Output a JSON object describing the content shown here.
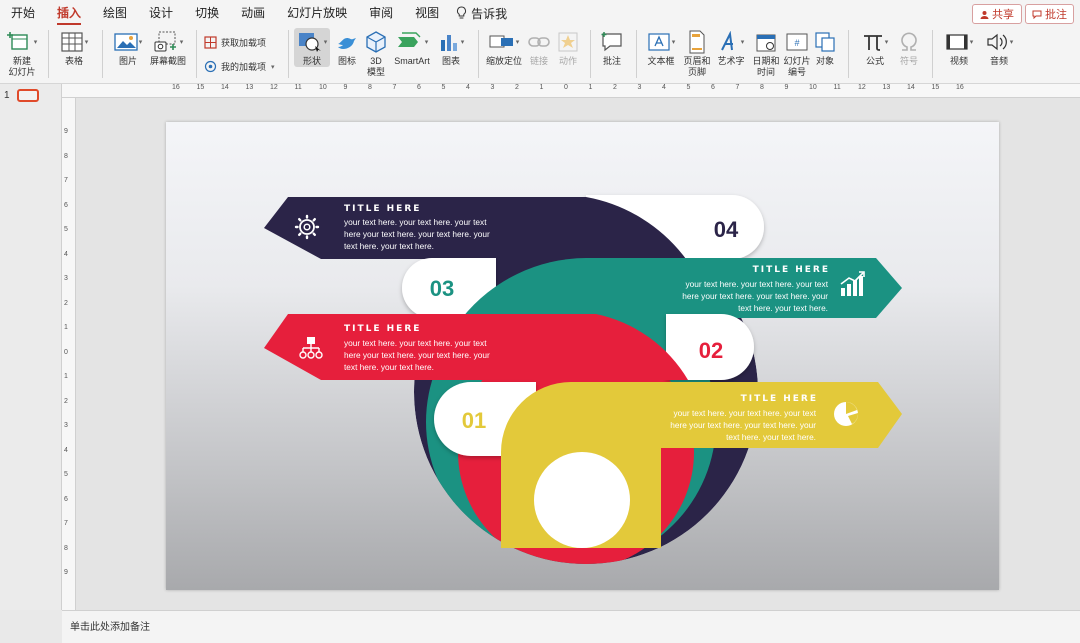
{
  "menu": {
    "items": [
      "开始",
      "插入",
      "绘图",
      "设计",
      "切换",
      "动画",
      "幻灯片放映",
      "审阅",
      "视图"
    ],
    "active": "插入",
    "tell_me": "告诉我",
    "share": "共享",
    "comments": "批注"
  },
  "ribbon": {
    "new_slide_1": "新建",
    "new_slide_2": "幻灯片",
    "table": "表格",
    "picture": "图片",
    "screenshot": "屏幕截图",
    "get_addins": "获取加载项",
    "my_addins": "我的加载项",
    "shapes": "形状",
    "icons": "图标",
    "model_1": "3D",
    "model_2": "模型",
    "smartart": "SmartArt",
    "chart": "图表",
    "zoom": "缩放定位",
    "link": "链接",
    "action": "动作",
    "comment": "批注",
    "textbox": "文本框",
    "header_1": "页眉和",
    "header_2": "页脚",
    "wordart": "艺术字",
    "datetime_1": "日期和",
    "datetime_2": "时间",
    "slidenum_1": "幻灯片",
    "slidenum_2": "编号",
    "object": "对象",
    "equation": "公式",
    "symbol": "符号",
    "video": "视频",
    "audio": "音频"
  },
  "ruler_numbers": [
    "16",
    "15",
    "14",
    "13",
    "12",
    "11",
    "10",
    "9",
    "8",
    "7",
    "6",
    "5",
    "4",
    "3",
    "2",
    "1",
    "0",
    "1",
    "2",
    "3",
    "4",
    "5",
    "6",
    "7",
    "8",
    "9",
    "10",
    "11",
    "12",
    "13",
    "14",
    "15",
    "16"
  ],
  "ruler_v_numbers": [
    "9",
    "8",
    "7",
    "6",
    "5",
    "4",
    "3",
    "2",
    "1",
    "0",
    "1",
    "2",
    "3",
    "4",
    "5",
    "6",
    "7",
    "8",
    "9"
  ],
  "thumbnail": {
    "number": "1"
  },
  "notes_placeholder": "单击此处添加备注",
  "slide": {
    "colors": {
      "navy": "#2b2448",
      "teal": "#1b9282",
      "red": "#e61f3c",
      "yellow": "#e3c93a"
    },
    "items": [
      {
        "number": "04",
        "title": "TITLE HERE",
        "lines": [
          "your text here. your text here. your text",
          "here your text here. your text here. your",
          "text here. your text here."
        ],
        "icon": "gear-icon"
      },
      {
        "number": "03",
        "title": "TITLE HERE",
        "lines": [
          "your text here. your text here. your text",
          "here your text here. your text here. your",
          "text here. your text here."
        ],
        "icon": "growth-chart-icon"
      },
      {
        "number": "02",
        "title": "TITLE HERE",
        "lines": [
          "your text here. your text here. your text",
          "here your text here. your text here. your",
          "text here. your text here."
        ],
        "icon": "org-chart-icon"
      },
      {
        "number": "01",
        "title": "TITLE HERE",
        "lines": [
          "your text here. your text here. your text",
          "here your text here. your text here. your",
          "text here. your text here."
        ],
        "icon": "pie-chart-icon"
      }
    ]
  }
}
